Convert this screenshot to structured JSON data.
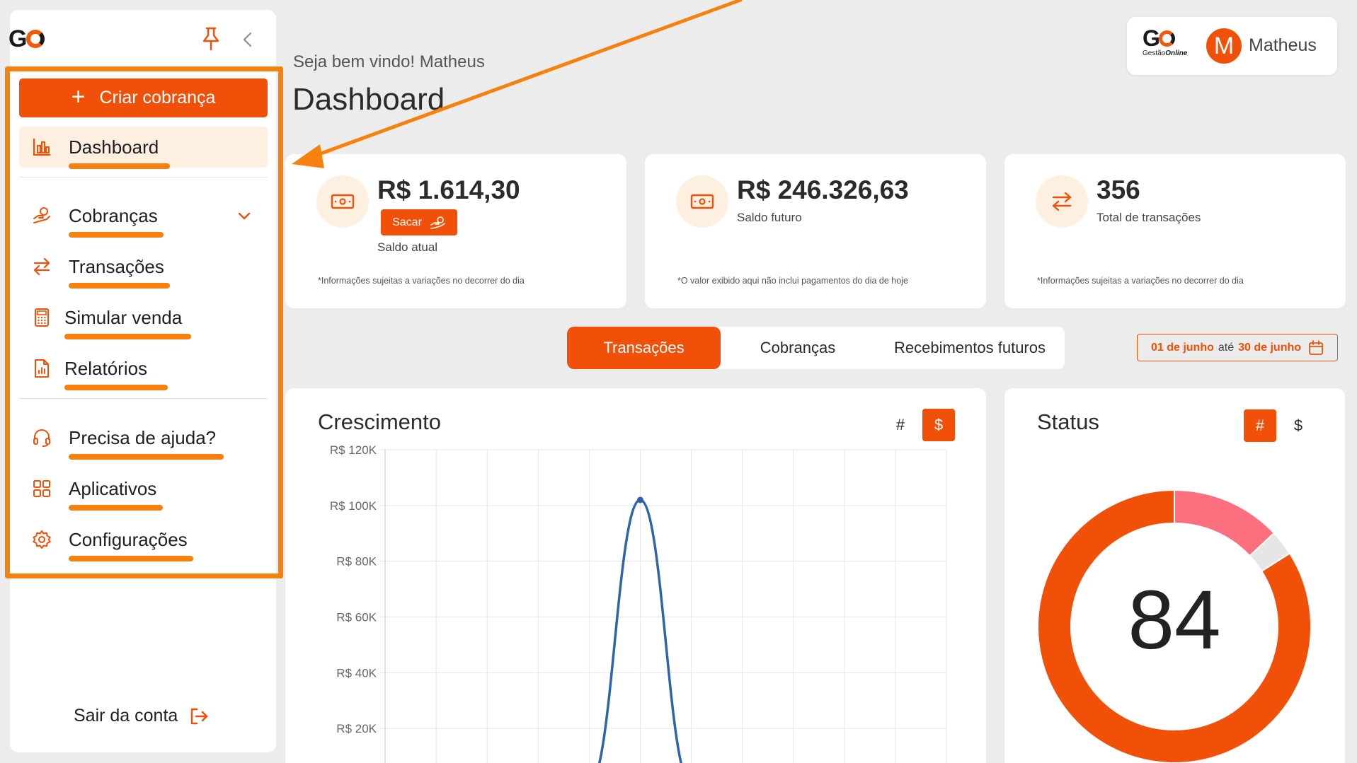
{
  "sidebar": {
    "logo_text": "GO",
    "create_button": "Criar cobrança",
    "items": [
      {
        "label": "Dashboard",
        "icon": "chart-bar-icon"
      },
      {
        "label": "Cobranças",
        "icon": "hand-coin-icon"
      },
      {
        "label": "Transações",
        "icon": "arrows-exchange-icon"
      },
      {
        "label": "Simular venda",
        "icon": "calculator-icon"
      },
      {
        "label": "Relatórios",
        "icon": "report-file-icon"
      },
      {
        "label": "Precisa de ajuda?",
        "icon": "headset-icon"
      },
      {
        "label": "Aplicativos",
        "icon": "apps-grid-icon"
      },
      {
        "label": "Configurações",
        "icon": "gear-icon"
      }
    ],
    "logout": "Sair da conta"
  },
  "header": {
    "welcome": "Seja bem vindo! Matheus",
    "title": "Dashboard",
    "brand_name": "GO",
    "brand_sub_prefix": "Gestão",
    "brand_sub_strong": "Online",
    "avatar_initial": "M",
    "user_name": "Matheus"
  },
  "stats": [
    {
      "value": "R$ 1.614,30",
      "label": "Saldo atual",
      "button": "Sacar",
      "note": "*Informações sujeitas a variações no decorrer do dia"
    },
    {
      "value": "R$ 246.326,63",
      "label": "Saldo futuro",
      "note": "*O valor exibido aqui não inclui pagamentos do dia de hoje"
    },
    {
      "value": "356",
      "label": "Total de transações",
      "note": "*Informações sujeitas a variações no decorrer do dia"
    }
  ],
  "tabs": [
    "Transações",
    "Cobranças",
    "Recebimentos futuros"
  ],
  "date_range": {
    "start": "01 de junho",
    "sep": "até",
    "end": "30 de junho"
  },
  "growth": {
    "title": "Crescimento",
    "hash": "#",
    "dollar": "$"
  },
  "status": {
    "title": "Status",
    "hash": "#",
    "dollar": "$",
    "center_value": "84"
  },
  "colors": {
    "accent": "#f05008",
    "highlight": "#f7810e",
    "line": "#2e64a8",
    "donut_pink": "#fb6f7e",
    "donut_grey": "#e6e6e6"
  },
  "chart_data": [
    {
      "type": "line",
      "title": "Crescimento",
      "ylim": [
        0,
        120000
      ],
      "y_ticks": [
        "R$ 120K",
        "R$ 100K",
        "R$ 80K",
        "R$ 60K",
        "R$ 40K",
        "R$ 20K"
      ],
      "y_tick_values": [
        120000,
        100000,
        80000,
        60000,
        40000,
        20000
      ],
      "grid": true,
      "series": [
        {
          "values": [
            0,
            0,
            0,
            0,
            0,
            102000,
            0,
            0,
            0,
            0,
            0,
            0
          ]
        }
      ]
    },
    {
      "type": "pie",
      "title": "Status",
      "center_label": "84",
      "slices": [
        {
          "value": 84,
          "color": "#f05008"
        },
        {
          "value": 13,
          "color": "#fb6f7e"
        },
        {
          "value": 3,
          "color": "#e6e6e6"
        }
      ]
    }
  ]
}
